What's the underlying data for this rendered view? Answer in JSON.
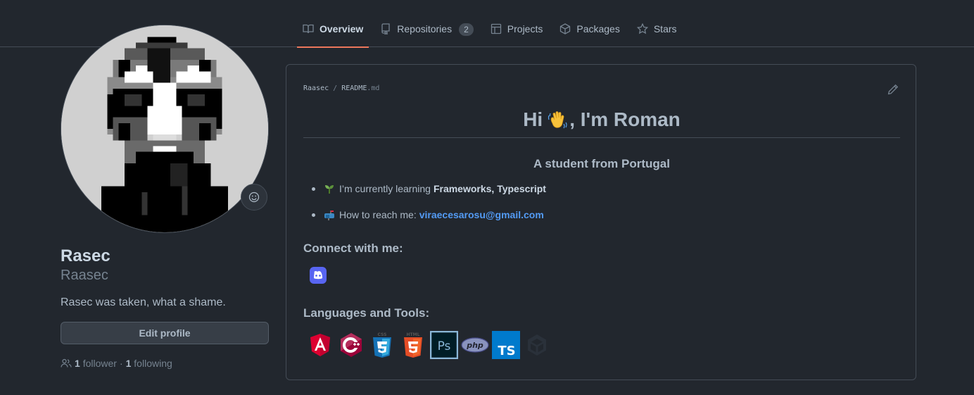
{
  "nav": {
    "tabs": [
      {
        "label": "Overview",
        "icon": "book-icon",
        "active": true
      },
      {
        "label": "Repositories",
        "icon": "repo-icon",
        "count": "2"
      },
      {
        "label": "Projects",
        "icon": "table-icon"
      },
      {
        "label": "Packages",
        "icon": "package-icon"
      },
      {
        "label": "Stars",
        "icon": "star-icon"
      }
    ]
  },
  "profile": {
    "fullname": "Rasec",
    "username": "Raasec",
    "bio": "Rasec was taken, what a shame.",
    "edit_label": "Edit profile",
    "followers_count": "1",
    "followers_label": "follower",
    "separator": "·",
    "following_count": "1",
    "following_label": "following"
  },
  "readme": {
    "owner": "Raasec",
    "sep": "/",
    "file": "README",
    "ext": ".md",
    "greeting_pre": "Hi",
    "greeting_post": ", I'm Roman",
    "subtitle": "A student from Portugal",
    "bullets": [
      {
        "icon": "seedling-icon",
        "text": "I’m currently learning",
        "strong": "Frameworks, Typescript"
      },
      {
        "icon": "mailbox-icon",
        "text": "How to reach me:",
        "link": "viraecesarosu@gmail.com"
      }
    ],
    "connect_heading": "Connect with me:",
    "tools_heading": "Languages and Tools:",
    "tools": [
      "angular",
      "c++",
      "css3",
      "html5",
      "photoshop",
      "php",
      "typescript",
      "unity"
    ]
  },
  "colors": {
    "bg": "#22272e",
    "border": "#444c56",
    "accent_underline": "#ec775c",
    "link": "#539bf5"
  }
}
